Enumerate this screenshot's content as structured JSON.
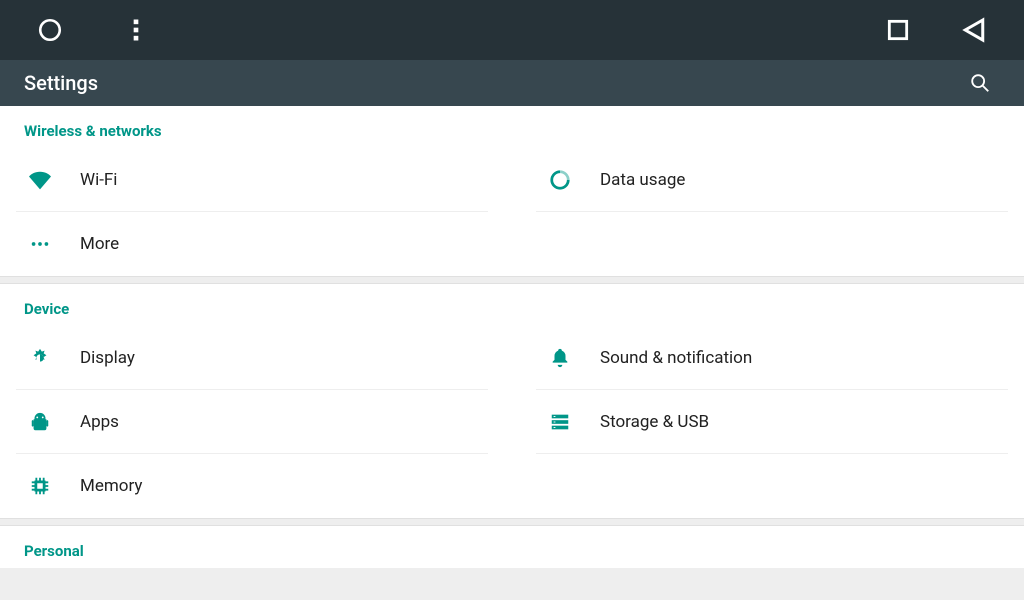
{
  "appbar": {
    "title": "Settings"
  },
  "sections": {
    "wireless": {
      "header": "Wireless & networks",
      "wifi": "Wi-Fi",
      "data_usage": "Data usage",
      "more": "More"
    },
    "device": {
      "header": "Device",
      "display": "Display",
      "sound": "Sound & notification",
      "apps": "Apps",
      "storage": "Storage & USB",
      "memory": "Memory"
    },
    "personal": {
      "header": "Personal"
    }
  },
  "colors": {
    "accent": "#009688",
    "systembar": "#263238",
    "appbar": "#37474f"
  }
}
